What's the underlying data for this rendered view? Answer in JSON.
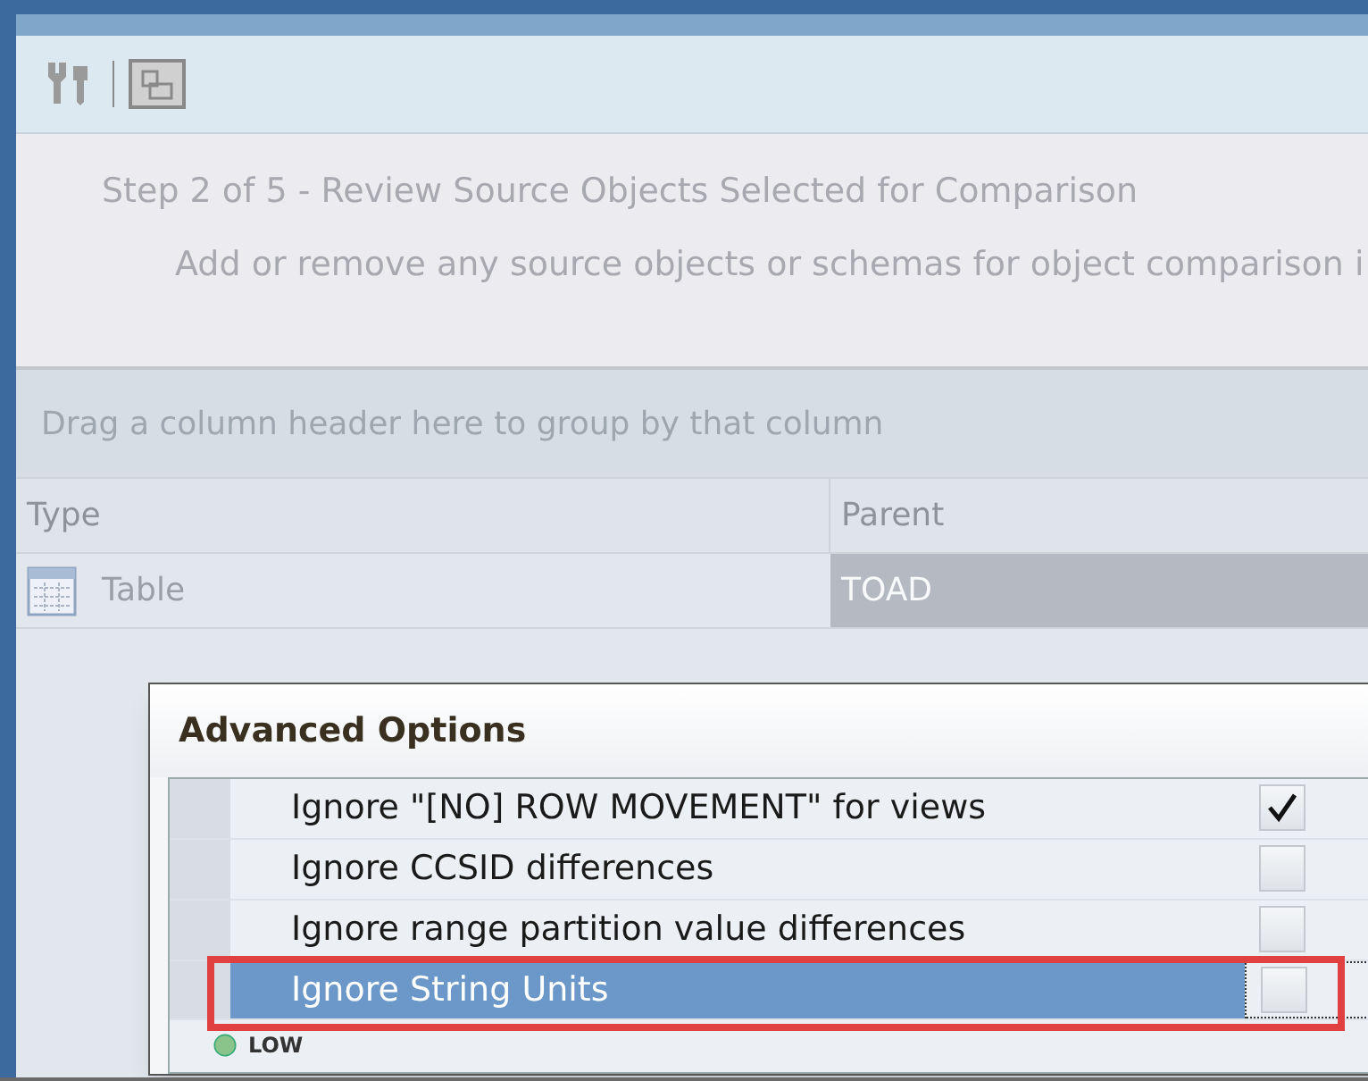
{
  "wizard": {
    "step_title": "Step 2 of 5 - Review Source Objects Selected for Comparison",
    "description": "Add or remove any source objects or schemas for object comparison i"
  },
  "grid": {
    "group_hint": "Drag a column header here to group by that column",
    "columns": [
      "Type",
      "Parent"
    ],
    "rows": [
      {
        "type": "Table",
        "parent": "TOAD"
      }
    ]
  },
  "dialog": {
    "title": "Advanced Options",
    "options": [
      {
        "label": "Ignore \"[NO] ROW MOVEMENT\" for views",
        "checked": true,
        "selected": false
      },
      {
        "label": "Ignore CCSID differences",
        "checked": false,
        "selected": false
      },
      {
        "label": "Ignore range partition value differences",
        "checked": false,
        "selected": false
      },
      {
        "label": "Ignore String Units",
        "checked": false,
        "selected": true
      }
    ],
    "group": {
      "label": "LOW"
    }
  }
}
